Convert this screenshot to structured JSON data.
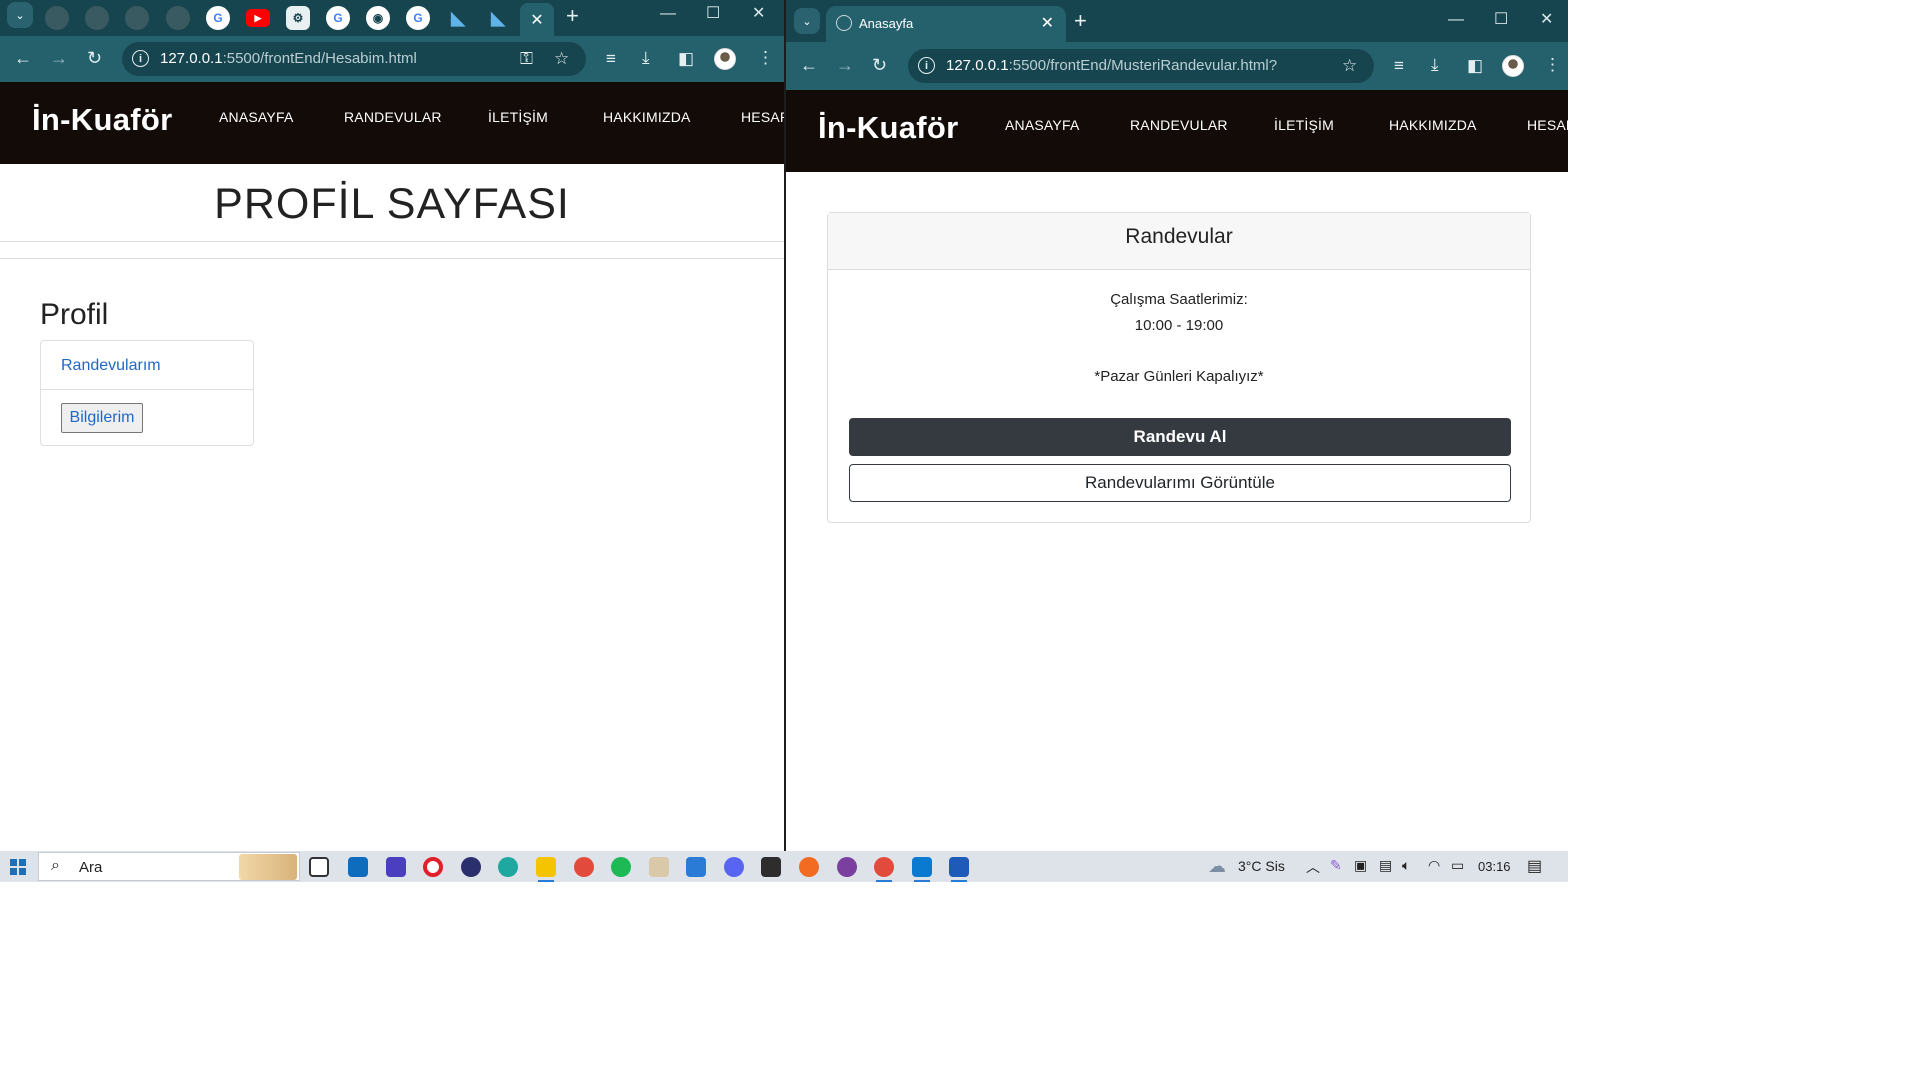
{
  "left_window": {
    "address": {
      "host": "127.0.0.1",
      "path": ":5500/frontEnd/Hesabim.html"
    },
    "site": {
      "brand": "İn-Kuaför",
      "nav": [
        "ANASAYFA",
        "RANDEVULAR",
        "İLETİŞİM",
        "HAKKIMIZDA",
        "HESAP"
      ]
    },
    "page_heading": "PROFİL SAYFASI",
    "profile": {
      "title": "Profil",
      "link_label": "Randevularım",
      "button_label": "Bilgilerim"
    }
  },
  "right_window": {
    "tab_title": "Anasayfa",
    "address": {
      "host": "127.0.0.1",
      "path": ":5500/frontEnd/MusteriRandevular.html?"
    },
    "site": {
      "brand": "İn-Kuaför",
      "nav": [
        "ANASAYFA",
        "RANDEVULAR",
        "İLETİŞİM",
        "HAKKIMIZDA",
        "HESAP"
      ]
    },
    "card": {
      "header": "Randevular",
      "hours_label": "Çalışma Saatlerimiz:",
      "hours_value": "10:00 - 19:00",
      "closed_note": "*Pazar Günleri Kapalıyız*",
      "primary_button": "Randevu Al",
      "secondary_button": "Randevularımı Görüntüle"
    }
  },
  "taskbar": {
    "search_placeholder": "Ara",
    "weather": "3°C  Sis",
    "clock": "03:16"
  },
  "colors": {
    "chrome_dark": "#16454f",
    "chrome_toolbar": "#24616d",
    "site_nav": "#120b08",
    "link_blue": "#2168c8",
    "button_dark": "#343a40"
  }
}
